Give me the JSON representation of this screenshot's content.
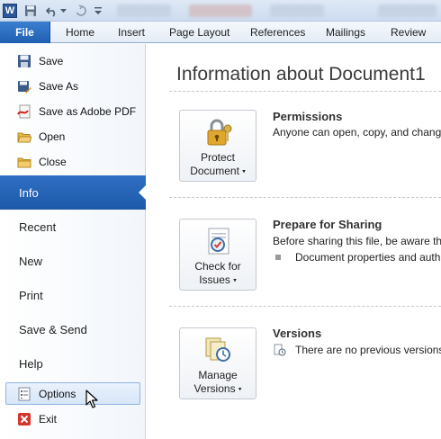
{
  "qat": {
    "app_logo_letter": "W",
    "icons": [
      "word-logo-icon",
      "save-icon",
      "undo-icon",
      "redo-icon",
      "customize-icon"
    ]
  },
  "tabs": {
    "file": "File",
    "items": [
      "Home",
      "Insert",
      "Page Layout",
      "References",
      "Mailings",
      "Review"
    ]
  },
  "nav": {
    "commands": [
      {
        "label": "Save",
        "icon": "save-icon"
      },
      {
        "label": "Save As",
        "icon": "save-as-icon"
      },
      {
        "label": "Save as Adobe PDF",
        "icon": "pdf-icon"
      },
      {
        "label": "Open",
        "icon": "open-folder-icon"
      },
      {
        "label": "Close",
        "icon": "close-folder-icon"
      }
    ],
    "sections": [
      "Info",
      "Recent",
      "New",
      "Print",
      "Save & Send",
      "Help"
    ],
    "active_section": "Info",
    "options": "Options",
    "exit": "Exit"
  },
  "main": {
    "title": "Information about Document1",
    "permissions": {
      "button": "Protect",
      "button_line2": "Document",
      "caret": "▾",
      "heading": "Permissions",
      "text": "Anyone can open, copy, and chang"
    },
    "sharing": {
      "button": "Check for",
      "button_line2": "Issues",
      "caret": "▾",
      "heading": "Prepare for Sharing",
      "text": "Before sharing this file, be aware tha",
      "bullet": "Document properties and auth"
    },
    "versions": {
      "button": "Manage",
      "button_line2": "Versions",
      "caret": "▾",
      "heading": "Versions",
      "text": "There are no previous versions"
    }
  },
  "colors": {
    "file_tab": "#2a6cc0",
    "active_section": "#2a68ba",
    "options_hover": "#d7e6f8"
  }
}
